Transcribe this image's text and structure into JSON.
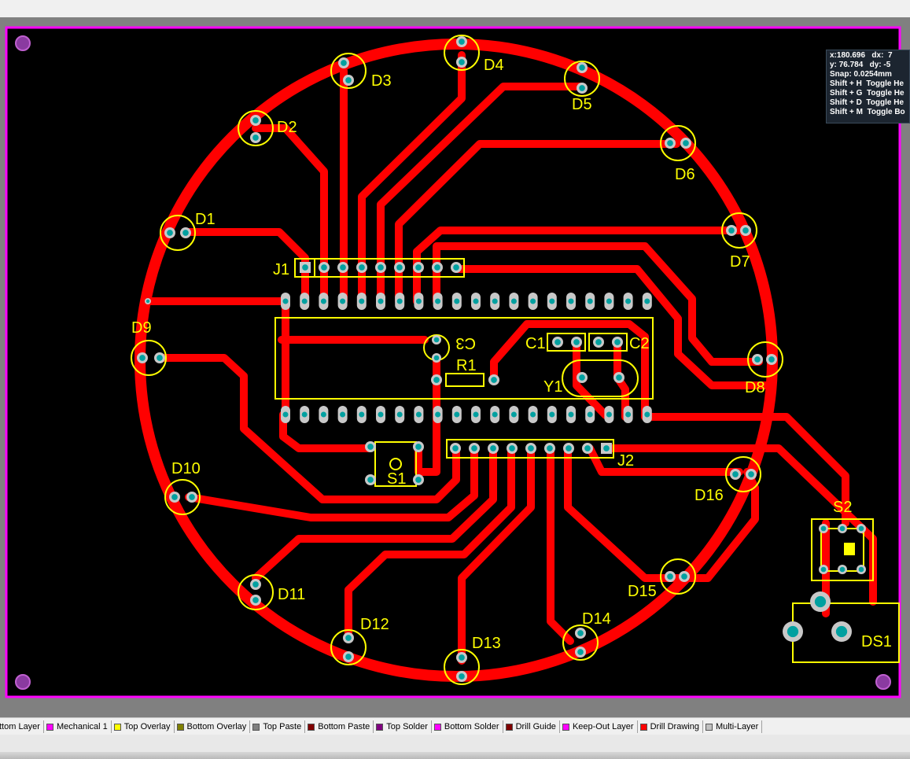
{
  "coordinates": {
    "x_label": "x:",
    "x_value": "180.696",
    "dx_label": "dx:",
    "dx_value": "7",
    "y_label": "y:",
    "y_value": "76.784",
    "dy_label": "dy:",
    "dy_value": "-5",
    "snap": "Snap: 0.0254mm"
  },
  "shortcuts": [
    {
      "key": "Shift + H",
      "action": "Toggle He"
    },
    {
      "key": "Shift + G",
      "action": "Toggle He"
    },
    {
      "key": "Shift + D",
      "action": "Toggle He"
    },
    {
      "key": "Shift + M",
      "action": "Toggle Bo"
    }
  ],
  "components": {
    "leds": [
      "D1",
      "D2",
      "D3",
      "D4",
      "D5",
      "D6",
      "D7",
      "D8",
      "D9",
      "D10",
      "D11",
      "D12",
      "D13",
      "D14",
      "D15",
      "D16"
    ],
    "j1": "J1",
    "j2": "J2",
    "c1": "C1",
    "c2": "C2",
    "c3": "C3",
    "r1": "R1",
    "y1": "Y1",
    "s1": "S1",
    "s2": "S2",
    "ds1": "DS1"
  },
  "layer_tabs": [
    {
      "label": "ttom Layer",
      "color": "#0000ff"
    },
    {
      "label": "Mechanical 1",
      "color": "#ff00ff"
    },
    {
      "label": "Top Overlay",
      "color": "#ffff00"
    },
    {
      "label": "Bottom Overlay",
      "color": "#808000"
    },
    {
      "label": "Top Paste",
      "color": "#808080"
    },
    {
      "label": "Bottom Paste",
      "color": "#800000"
    },
    {
      "label": "Top Solder",
      "color": "#800080"
    },
    {
      "label": "Bottom Solder",
      "color": "#ff00ff"
    },
    {
      "label": "Drill Guide",
      "color": "#800000"
    },
    {
      "label": "Keep-Out Layer",
      "color": "#ff00ff"
    },
    {
      "label": "Drill Drawing",
      "color": "#ff0000"
    },
    {
      "label": "Multi-Layer",
      "color": "#c0c0c0"
    }
  ],
  "colors": {
    "board": "#000000",
    "board_outline": "#ff00ff",
    "copper": "#ff0000",
    "silkscreen": "#ffff00",
    "pad": "#c8c8c8",
    "pad_hole": "#00a0a0"
  }
}
